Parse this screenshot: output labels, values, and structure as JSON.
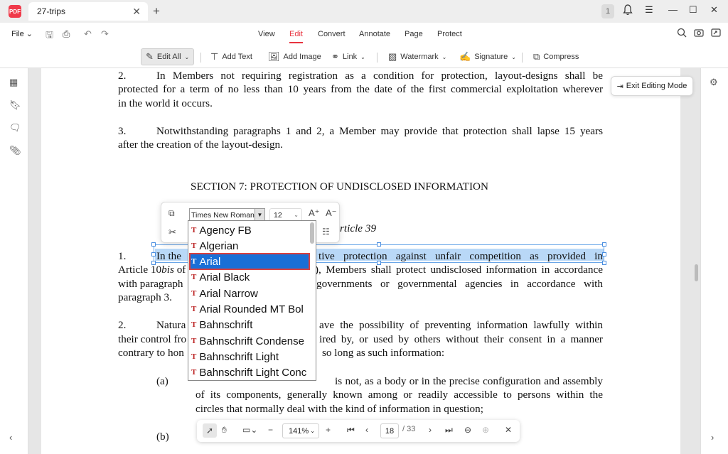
{
  "window": {
    "tab_title": "27-trips",
    "page_badge": "1"
  },
  "menu": {
    "file": "File",
    "items": [
      "View",
      "Edit",
      "Convert",
      "Annotate",
      "Page",
      "Protect"
    ],
    "active": "Edit"
  },
  "toolbar": {
    "edit_all": "Edit All",
    "add_text": "Add Text",
    "add_image": "Add Image",
    "link": "Link",
    "watermark": "Watermark",
    "signature": "Signature",
    "compress": "Compress"
  },
  "exit_editing": "Exit Editing Mode",
  "document": {
    "para2_num": "2.",
    "para2_line1": "In Members not requiring registration as a condition for protection, layout-designs shall be",
    "para2_line2": "protected for a term of no less than 10 years from the date of the first commercial exploitation wherever",
    "para2_line3": "in the world it occurs.",
    "para3_num": "3.",
    "para3_line1": "Notwithstanding paragraphs 1 and 2, a Member may provide that protection shall lapse 15 years",
    "para3_line2": "after the creation of the layout-design.",
    "section_heading": "SECTION 7:  PROTECTION OF UNDISCLOSED INFORMATION",
    "article": "rticle 39",
    "a39_p1_num": "1.",
    "a39_p1_line1_start": "In the",
    "a39_p1_line1_end": "tive protection against unfair competition as provided in",
    "a39_p1_line2_start": "Article 10",
    "a39_p1_line2_bis": "bis",
    "a39_p1_line2_of": " of",
    "a39_p1_line2_end": "), Members shall protect undisclosed information in accordance",
    "a39_p1_line3_start": "with paragraph",
    "a39_p1_line3_end": "governments or governmental agencies in accordance with",
    "a39_p1_line4": "paragraph 3.",
    "a39_p2_num": "2.",
    "a39_p2_line1_start": "Natura",
    "a39_p2_line1_end": "ave the possibility of preventing information lawfully within",
    "a39_p2_line2_start": "their control fro",
    "a39_p2_line2_end": "ired by, or used by others without their consent in a manner",
    "a39_p2_line3_start": "contrary to hon",
    "a39_p2_line3_end": "so long as such information:",
    "item_a_label": "(a)",
    "item_a_line1_end": "is not, as a body or in the precise configuration and assembly",
    "item_a_line2": "of its components, generally known among or readily accessible to persons within the",
    "item_a_line3": "circles that normally deal with the kind of information in question;",
    "item_b_label": "(b)"
  },
  "font_toolbar": {
    "font_name": "Times New Roman",
    "font_size": "12"
  },
  "font_list": {
    "items": [
      "Agency FB",
      "Algerian",
      "Arial",
      "Arial Black",
      "Arial Narrow",
      "Arial Rounded MT Bol",
      "Bahnschrift",
      "Bahnschrift Condense",
      "Bahnschrift Light",
      "Bahnschrift Light Conc"
    ],
    "selected": "Arial"
  },
  "nav": {
    "zoom": "141%",
    "current_page": "18",
    "total_pages": "/ 33"
  }
}
